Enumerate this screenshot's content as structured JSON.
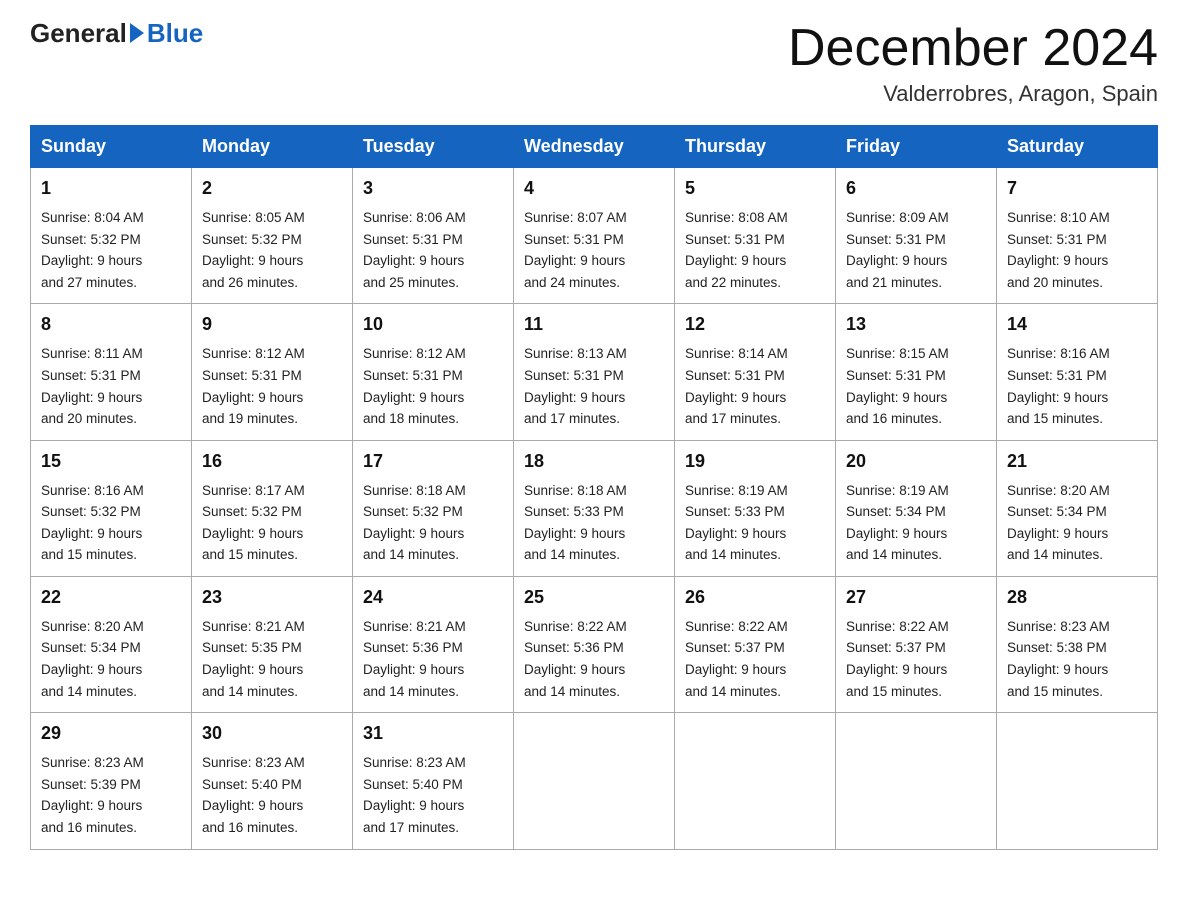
{
  "logo": {
    "general": "General",
    "blue": "Blue"
  },
  "header": {
    "month_title": "December 2024",
    "location": "Valderrobres, Aragon, Spain"
  },
  "days_of_week": [
    "Sunday",
    "Monday",
    "Tuesday",
    "Wednesday",
    "Thursday",
    "Friday",
    "Saturday"
  ],
  "weeks": [
    [
      {
        "day": "1",
        "info": "Sunrise: 8:04 AM\nSunset: 5:32 PM\nDaylight: 9 hours\nand 27 minutes."
      },
      {
        "day": "2",
        "info": "Sunrise: 8:05 AM\nSunset: 5:32 PM\nDaylight: 9 hours\nand 26 minutes."
      },
      {
        "day": "3",
        "info": "Sunrise: 8:06 AM\nSunset: 5:31 PM\nDaylight: 9 hours\nand 25 minutes."
      },
      {
        "day": "4",
        "info": "Sunrise: 8:07 AM\nSunset: 5:31 PM\nDaylight: 9 hours\nand 24 minutes."
      },
      {
        "day": "5",
        "info": "Sunrise: 8:08 AM\nSunset: 5:31 PM\nDaylight: 9 hours\nand 22 minutes."
      },
      {
        "day": "6",
        "info": "Sunrise: 8:09 AM\nSunset: 5:31 PM\nDaylight: 9 hours\nand 21 minutes."
      },
      {
        "day": "7",
        "info": "Sunrise: 8:10 AM\nSunset: 5:31 PM\nDaylight: 9 hours\nand 20 minutes."
      }
    ],
    [
      {
        "day": "8",
        "info": "Sunrise: 8:11 AM\nSunset: 5:31 PM\nDaylight: 9 hours\nand 20 minutes."
      },
      {
        "day": "9",
        "info": "Sunrise: 8:12 AM\nSunset: 5:31 PM\nDaylight: 9 hours\nand 19 minutes."
      },
      {
        "day": "10",
        "info": "Sunrise: 8:12 AM\nSunset: 5:31 PM\nDaylight: 9 hours\nand 18 minutes."
      },
      {
        "day": "11",
        "info": "Sunrise: 8:13 AM\nSunset: 5:31 PM\nDaylight: 9 hours\nand 17 minutes."
      },
      {
        "day": "12",
        "info": "Sunrise: 8:14 AM\nSunset: 5:31 PM\nDaylight: 9 hours\nand 17 minutes."
      },
      {
        "day": "13",
        "info": "Sunrise: 8:15 AM\nSunset: 5:31 PM\nDaylight: 9 hours\nand 16 minutes."
      },
      {
        "day": "14",
        "info": "Sunrise: 8:16 AM\nSunset: 5:31 PM\nDaylight: 9 hours\nand 15 minutes."
      }
    ],
    [
      {
        "day": "15",
        "info": "Sunrise: 8:16 AM\nSunset: 5:32 PM\nDaylight: 9 hours\nand 15 minutes."
      },
      {
        "day": "16",
        "info": "Sunrise: 8:17 AM\nSunset: 5:32 PM\nDaylight: 9 hours\nand 15 minutes."
      },
      {
        "day": "17",
        "info": "Sunrise: 8:18 AM\nSunset: 5:32 PM\nDaylight: 9 hours\nand 14 minutes."
      },
      {
        "day": "18",
        "info": "Sunrise: 8:18 AM\nSunset: 5:33 PM\nDaylight: 9 hours\nand 14 minutes."
      },
      {
        "day": "19",
        "info": "Sunrise: 8:19 AM\nSunset: 5:33 PM\nDaylight: 9 hours\nand 14 minutes."
      },
      {
        "day": "20",
        "info": "Sunrise: 8:19 AM\nSunset: 5:34 PM\nDaylight: 9 hours\nand 14 minutes."
      },
      {
        "day": "21",
        "info": "Sunrise: 8:20 AM\nSunset: 5:34 PM\nDaylight: 9 hours\nand 14 minutes."
      }
    ],
    [
      {
        "day": "22",
        "info": "Sunrise: 8:20 AM\nSunset: 5:34 PM\nDaylight: 9 hours\nand 14 minutes."
      },
      {
        "day": "23",
        "info": "Sunrise: 8:21 AM\nSunset: 5:35 PM\nDaylight: 9 hours\nand 14 minutes."
      },
      {
        "day": "24",
        "info": "Sunrise: 8:21 AM\nSunset: 5:36 PM\nDaylight: 9 hours\nand 14 minutes."
      },
      {
        "day": "25",
        "info": "Sunrise: 8:22 AM\nSunset: 5:36 PM\nDaylight: 9 hours\nand 14 minutes."
      },
      {
        "day": "26",
        "info": "Sunrise: 8:22 AM\nSunset: 5:37 PM\nDaylight: 9 hours\nand 14 minutes."
      },
      {
        "day": "27",
        "info": "Sunrise: 8:22 AM\nSunset: 5:37 PM\nDaylight: 9 hours\nand 15 minutes."
      },
      {
        "day": "28",
        "info": "Sunrise: 8:23 AM\nSunset: 5:38 PM\nDaylight: 9 hours\nand 15 minutes."
      }
    ],
    [
      {
        "day": "29",
        "info": "Sunrise: 8:23 AM\nSunset: 5:39 PM\nDaylight: 9 hours\nand 16 minutes."
      },
      {
        "day": "30",
        "info": "Sunrise: 8:23 AM\nSunset: 5:40 PM\nDaylight: 9 hours\nand 16 minutes."
      },
      {
        "day": "31",
        "info": "Sunrise: 8:23 AM\nSunset: 5:40 PM\nDaylight: 9 hours\nand 17 minutes."
      },
      {
        "day": "",
        "info": ""
      },
      {
        "day": "",
        "info": ""
      },
      {
        "day": "",
        "info": ""
      },
      {
        "day": "",
        "info": ""
      }
    ]
  ]
}
